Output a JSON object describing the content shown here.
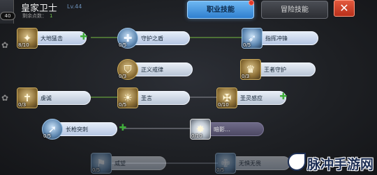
{
  "header": {
    "job_title": "皇家卫士",
    "job_level": "Lv.44",
    "points_label": "剩余点数：",
    "points_value": "1",
    "player_level": "40",
    "tabs": [
      {
        "label": "职业技能",
        "active": true
      },
      {
        "label": "冒险技能",
        "active": false
      }
    ],
    "close_label": "✕"
  },
  "skills": [
    {
      "name": "大地猛击",
      "level": "8/10"
    },
    {
      "name": "守护之盾",
      "level": "0/5"
    },
    {
      "name": "指挥冲锋",
      "level": "0/5"
    },
    {
      "name": "正义戒律",
      "level": "0/3"
    },
    {
      "name": "王者守护",
      "level": "0/3"
    },
    {
      "name": "虔诚",
      "level": "0/3"
    },
    {
      "name": "圣言",
      "level": "0/5"
    },
    {
      "name": "圣灵感应",
      "level": "0/10"
    },
    {
      "name": "长枪突刺",
      "level": "0/5"
    },
    {
      "name": "暗影…",
      "level": "0/10"
    },
    {
      "name": "威望",
      "level": "0/5"
    },
    {
      "name": "无惧无畏",
      "level": "0/5"
    }
  ],
  "watermark": {
    "text": "脉冲手游网"
  },
  "colors": {
    "tab_active": "#2f7fcf",
    "close": "#b8301b",
    "plus": "#3fae3a",
    "connector": "#5b8a3a"
  }
}
